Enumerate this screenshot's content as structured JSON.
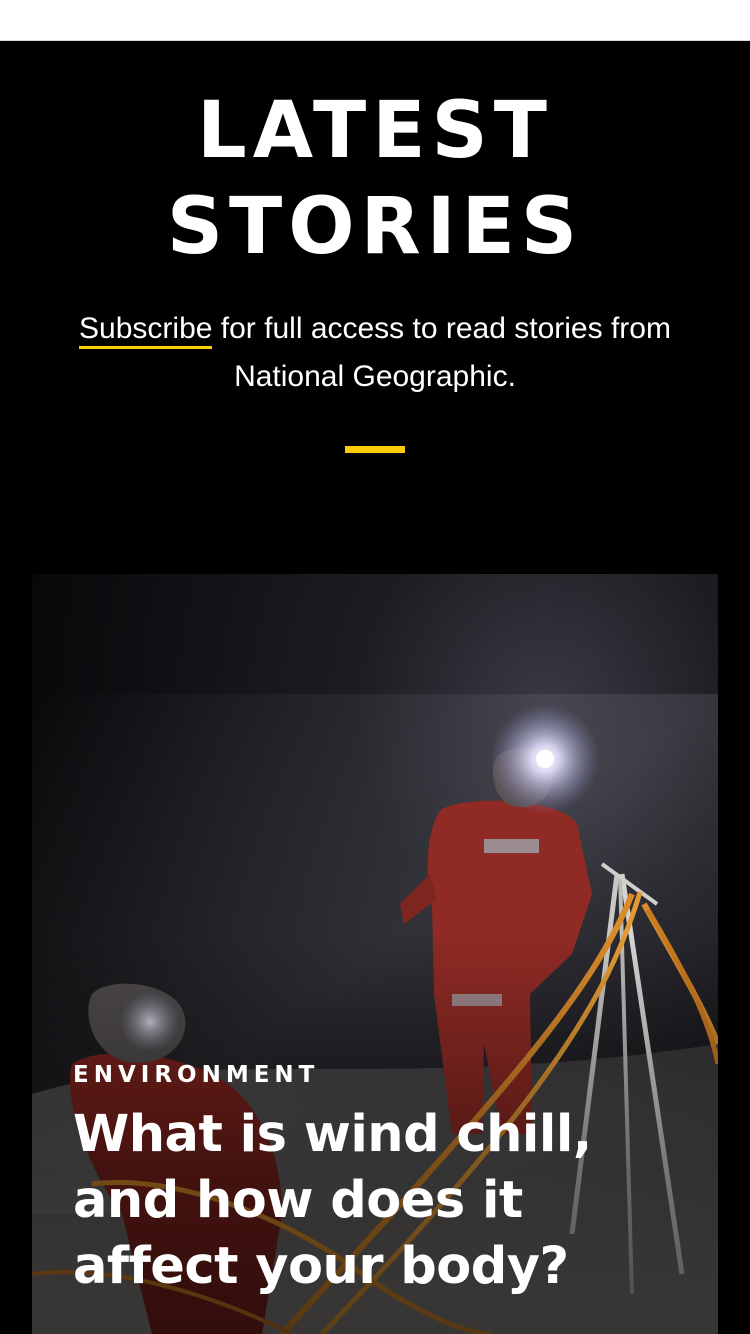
{
  "header": {
    "title_line1": "LATEST",
    "title_line2": "STORIES"
  },
  "intro": {
    "subscribe_link": "Subscribe",
    "text": " for full access to read stories from National Geographic."
  },
  "colors": {
    "accent": "#fccc0a",
    "background": "#000000"
  },
  "story": {
    "kicker": "ENVIRONMENT",
    "headline": "What is wind chill, and how does it affect your body?",
    "image_icon": "photo-polar-researchers-in-storm"
  }
}
